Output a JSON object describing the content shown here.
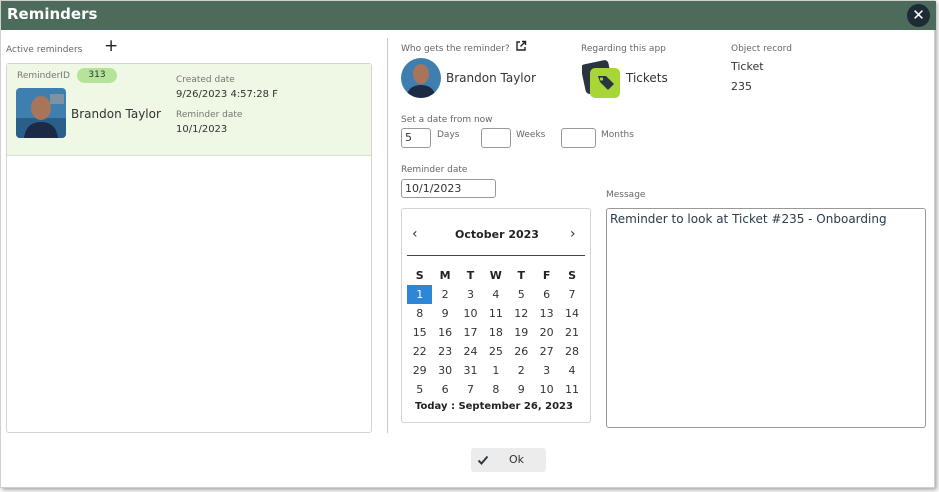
{
  "window": {
    "title": "Reminders",
    "close_icon": "close-icon"
  },
  "colors": {
    "titlebar": "#4d6b5b",
    "card_bg": "#eef8e4",
    "badge": "#b5e39a",
    "selected_day": "#2e86d6"
  },
  "active_reminders": {
    "label": "Active reminders",
    "add_icon": "plus-icon",
    "items": [
      {
        "id_label": "ReminderID",
        "id_value": "313",
        "name": "Brandon Taylor",
        "created_label": "Created date",
        "created_value": "9/26/2023 4:57:28 F",
        "reminder_label": "Reminder date",
        "reminder_value": "10/1/2023"
      }
    ]
  },
  "who": {
    "label": "Who gets the reminder?",
    "name": "Brandon Taylor",
    "link_icon": "external-link-icon"
  },
  "regarding": {
    "label": "Regarding this app",
    "app_name": "Tickets",
    "app_icon": "tickets-tag-icon"
  },
  "object_record": {
    "label": "Object record",
    "type": "Ticket",
    "id": "235"
  },
  "set_date": {
    "label": "Set a date from now",
    "days_value": "5",
    "days_label": "Days",
    "weeks_value": "",
    "weeks_label": "Weeks",
    "months_value": "",
    "months_label": "Months"
  },
  "reminder_date": {
    "label": "Reminder date",
    "value": "10/1/2023"
  },
  "calendar": {
    "month": "October 2023",
    "weekdays": [
      "S",
      "M",
      "T",
      "W",
      "T",
      "F",
      "S"
    ],
    "weeks": [
      [
        "1",
        "2",
        "3",
        "4",
        "5",
        "6",
        "7"
      ],
      [
        "8",
        "9",
        "10",
        "11",
        "12",
        "13",
        "14"
      ],
      [
        "15",
        "16",
        "17",
        "18",
        "19",
        "20",
        "21"
      ],
      [
        "22",
        "23",
        "24",
        "25",
        "26",
        "27",
        "28"
      ],
      [
        "29",
        "30",
        "31",
        "1",
        "2",
        "3",
        "4"
      ],
      [
        "5",
        "6",
        "7",
        "8",
        "9",
        "10",
        "11"
      ]
    ],
    "selected": "1",
    "today": "Today : September 26, 2023"
  },
  "message": {
    "label": "Message",
    "text": "Reminder to look at Ticket #235 - Onboarding"
  },
  "footer": {
    "ok_label": "Ok",
    "ok_icon": "checkmark-icon"
  }
}
